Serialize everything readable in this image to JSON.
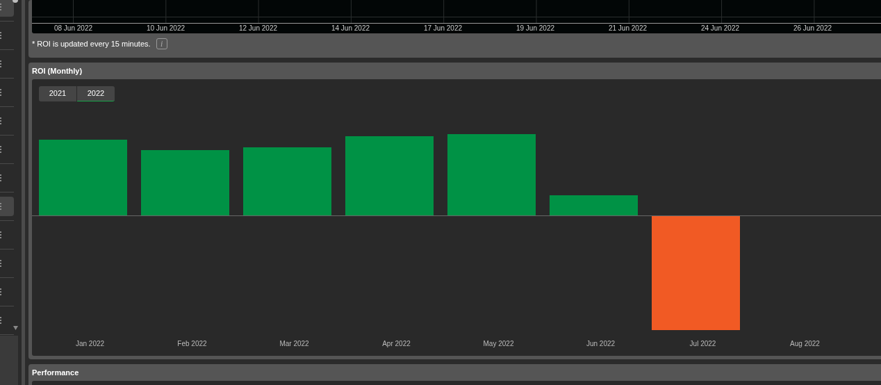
{
  "sidebar": {
    "items": [
      {
        "selected": true
      },
      {
        "selected": false
      },
      {
        "selected": false
      },
      {
        "selected": false
      },
      {
        "selected": false
      },
      {
        "selected": false
      },
      {
        "selected": false
      },
      {
        "selected": true
      },
      {
        "selected": false
      },
      {
        "selected": false
      },
      {
        "selected": false
      },
      {
        "selected": false
      }
    ]
  },
  "roi_chart": {
    "x_labels": [
      "08 Jun 2022",
      "10 Jun 2022",
      "12 Jun 2022",
      "14 Jun 2022",
      "17 Jun 2022",
      "19 Jun 2022",
      "21 Jun 2022",
      "24 Jun 2022",
      "26 Jun 2022"
    ],
    "note": "* ROI is updated every 15 minutes.",
    "info_icon": "i"
  },
  "roi_monthly": {
    "title": "ROI (Monthly)",
    "years": [
      {
        "label": "2021",
        "selected": false
      },
      {
        "label": "2022",
        "selected": true
      }
    ],
    "months": [
      "Jan 2022",
      "Feb 2022",
      "Mar 2022",
      "Apr 2022",
      "May 2022",
      "Jun 2022",
      "Jul 2022",
      "Aug 2022"
    ]
  },
  "performance": {
    "title": "Performance"
  }
}
